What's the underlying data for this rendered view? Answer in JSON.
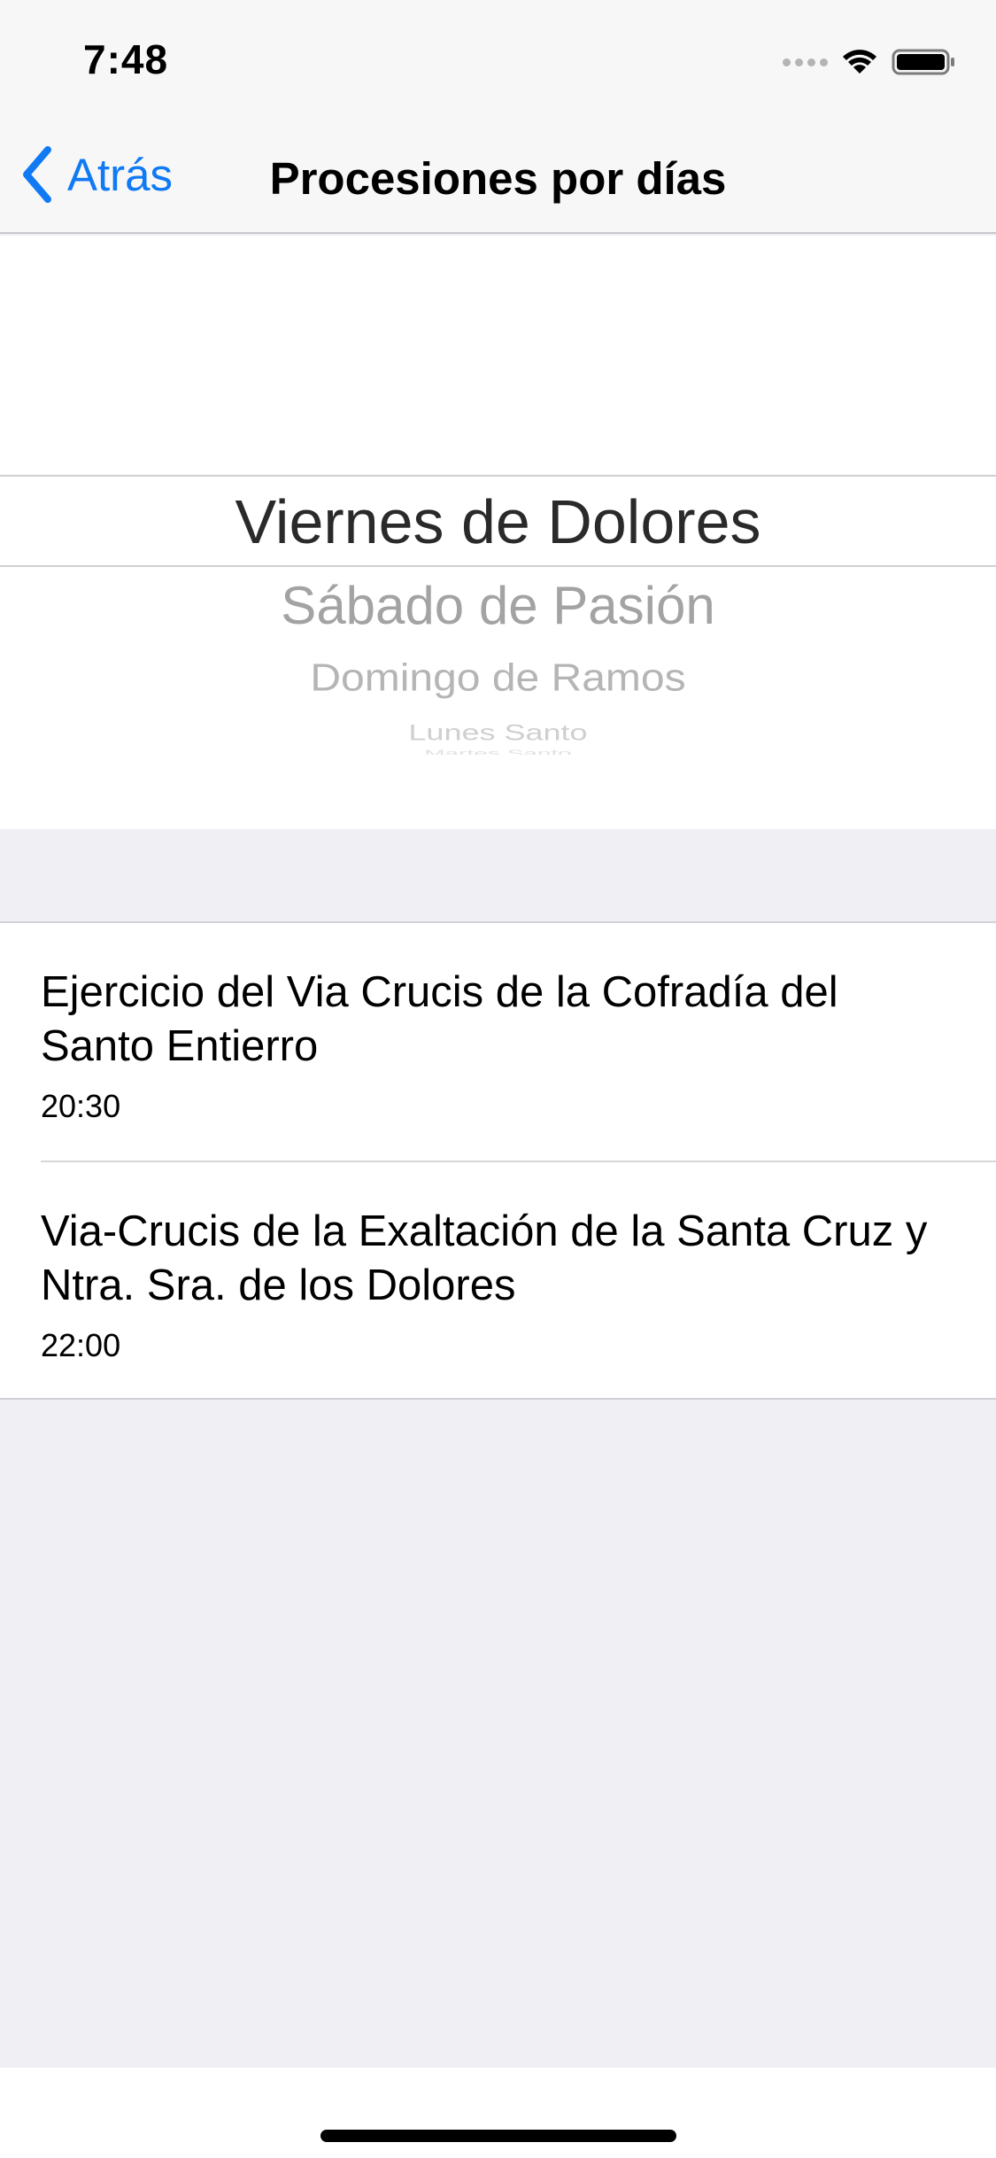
{
  "status_bar": {
    "time": "7:48"
  },
  "navbar": {
    "back_label": "Atrás",
    "title": "Procesiones por días"
  },
  "picker": {
    "selected": "Viernes de Dolores",
    "items": [
      "Sábado de Pasión",
      "Domingo de Ramos",
      "Lunes Santo",
      "Martes Santo"
    ]
  },
  "list": {
    "items": [
      {
        "title": "Ejercicio del Via Crucis de la Cofradía del Santo Entierro",
        "time": "20:30"
      },
      {
        "title": "Via-Crucis de la Exaltación de la Santa Cruz y Ntra. Sra. de los Dolores",
        "time": "22:00"
      }
    ]
  },
  "colors": {
    "accent": "#1079f4",
    "background": "#efeff4",
    "bar": "#f7f7f7"
  },
  "icons": [
    "signal-dots-icon",
    "wifi-icon",
    "battery-icon",
    "chevron-left-icon"
  ]
}
